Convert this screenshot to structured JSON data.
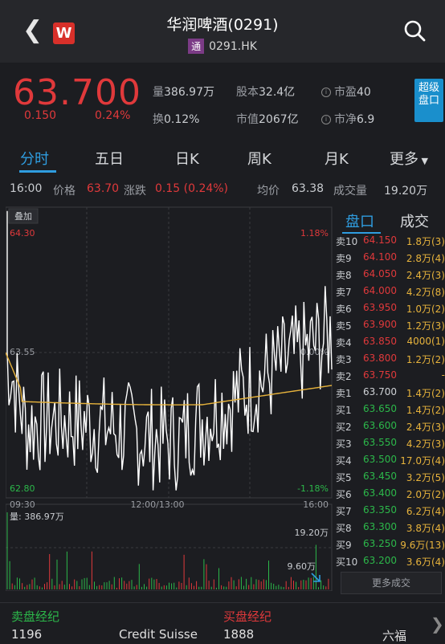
{
  "header": {
    "title": "华润啤酒(0291)",
    "exchange_badge": "通",
    "code": "0291.HK"
  },
  "quote": {
    "price": "63.700",
    "change": "0.150",
    "change_pct": "0.24%",
    "volume_label": "量",
    "volume": "386.97万",
    "turnover_label": "换",
    "turnover": "0.12%",
    "shares_label": "股本",
    "shares": "32.4亿",
    "mktcap_label": "市值",
    "mktcap": "2067亿",
    "pe_label": "市盈",
    "pe": "40",
    "pb_label": "市净",
    "pb": "6.9",
    "super_btn": "超级盘口"
  },
  "tabs": [
    "分时",
    "五日",
    "日K",
    "周K",
    "月K",
    "更多"
  ],
  "status": {
    "time": "16:00",
    "price_label": "价格",
    "price": "63.70",
    "chg_label": "涨跌",
    "chg": "0.15 (0.24%)",
    "avg_label": "均价",
    "avg": "63.38",
    "vol_label": "成交量",
    "vol": "19.20万"
  },
  "chart": {
    "overlay_btn": "叠加",
    "y_high": "64.30",
    "y_mid": "63.55",
    "y_low": "62.80",
    "pct_high": "1.18%",
    "pct_mid": "0.00%",
    "pct_low": "-1.18%",
    "t_start": "09:30",
    "t_mid": "12:00/13:00",
    "t_end": "16:00",
    "vol_label": "量: 386.97万",
    "vol_high": "19.20万",
    "vol_mid": "9.60万"
  },
  "colors": {
    "up": "#e0393b",
    "down": "#2cb84a",
    "price_line": "#ffffff",
    "avg_line": "#e7b33c",
    "accent": "#2f9de0"
  },
  "book_tabs": [
    "盘口",
    "成交"
  ],
  "order_book": [
    {
      "label": "卖10",
      "price": "64.150",
      "vol": "1.8万(3)"
    },
    {
      "label": "卖9",
      "price": "64.100",
      "vol": "2.8万(4)"
    },
    {
      "label": "卖8",
      "price": "64.050",
      "vol": "2.4万(3)"
    },
    {
      "label": "卖7",
      "price": "64.000",
      "vol": "4.2万(8)"
    },
    {
      "label": "卖6",
      "price": "63.950",
      "vol": "1.0万(2)"
    },
    {
      "label": "卖5",
      "price": "63.900",
      "vol": "1.2万(3)"
    },
    {
      "label": "卖4",
      "price": "63.850",
      "vol": "4000(1)"
    },
    {
      "label": "卖3",
      "price": "63.800",
      "vol": "1.2万(2)"
    },
    {
      "label": "卖2",
      "price": "63.750",
      "vol": "-"
    },
    {
      "label": "卖1",
      "price": "63.700",
      "vol": "1.4万(2)"
    },
    {
      "label": "买1",
      "price": "63.650",
      "vol": "1.4万(2)"
    },
    {
      "label": "买2",
      "price": "63.600",
      "vol": "2.4万(3)"
    },
    {
      "label": "买3",
      "price": "63.550",
      "vol": "4.2万(3)"
    },
    {
      "label": "买4",
      "price": "63.500",
      "vol": "17.0万(4)"
    },
    {
      "label": "买5",
      "price": "63.450",
      "vol": "3.2万(5)"
    },
    {
      "label": "买6",
      "price": "63.400",
      "vol": "2.0万(2)"
    },
    {
      "label": "买7",
      "price": "63.350",
      "vol": "6.2万(4)"
    },
    {
      "label": "买8",
      "price": "63.300",
      "vol": "3.8万(4)"
    },
    {
      "label": "买9",
      "price": "63.250",
      "vol": "9.6万(13)"
    },
    {
      "label": "买10",
      "price": "63.200",
      "vol": "3.6万(4)"
    }
  ],
  "more_trades": "更多成交",
  "broker": {
    "sell_title": "卖盘经纪",
    "buy_title": "买盘经纪",
    "sell_id": "1196",
    "sell_name": "Credit Suisse",
    "buy_id": "1888",
    "buy_name": "六福"
  }
}
